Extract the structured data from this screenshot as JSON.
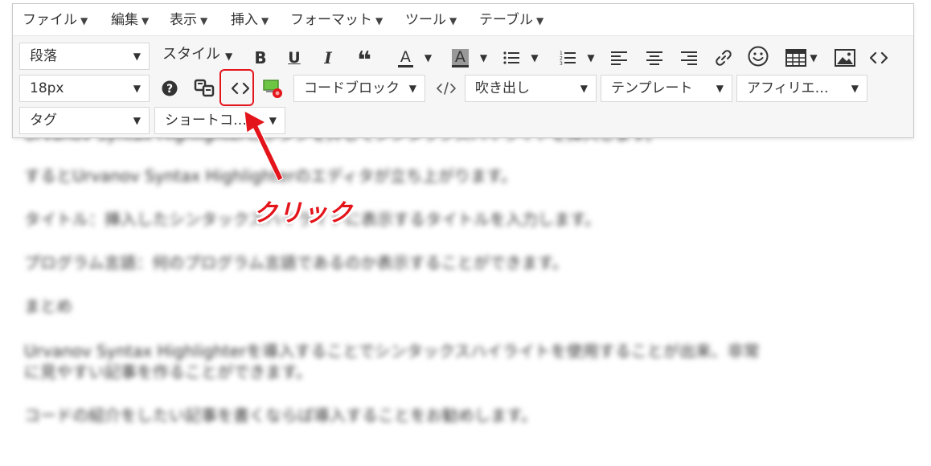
{
  "menubar": {
    "items": [
      "ファイル",
      "編集",
      "表示",
      "挿入",
      "フォーマット",
      "ツール",
      "テーブル"
    ]
  },
  "toolbar": {
    "paragraph_select": "段落",
    "style_select": "スタイル",
    "bold_label": "B",
    "underline_label": "U",
    "italic_label": "I",
    "quote_label": "❝",
    "text_color_label": "A",
    "bg_color_label": "A",
    "font_size_select": "18px",
    "code_block_select": "コードブロック",
    "balloon_select": "吹き出し",
    "template_select": "テンプレート",
    "affiliate_select": "アフィリエ…",
    "tag_select": "タグ",
    "shortcode_select": "ショートコ…",
    "help_label": "?"
  },
  "annotation": {
    "label": "クリック",
    "color": "#e4141b"
  },
  "article": {
    "lines": [
      "Urvanov Syntax Highlighterのボタンを押してシンタックスハイライトを挿入します。",
      "するとUrvanov Syntax Highlighterのエディタが立ち上がります。",
      "タイトル：挿入したシンタックスハイライトに表示するタイトルを入力します。",
      "プログラム言語：何のプログラム言語であるのか表示することができます。",
      "まとめ",
      "Urvanov Syntax Highlighterを導入することでシンタックスハイライトを使用することが出来、非常",
      "に見やすい記事を作ることができます。",
      "コードの紹介をしたい記事を書くならば導入することをお勧めします。"
    ],
    "link_text": "Urvanov"
  }
}
